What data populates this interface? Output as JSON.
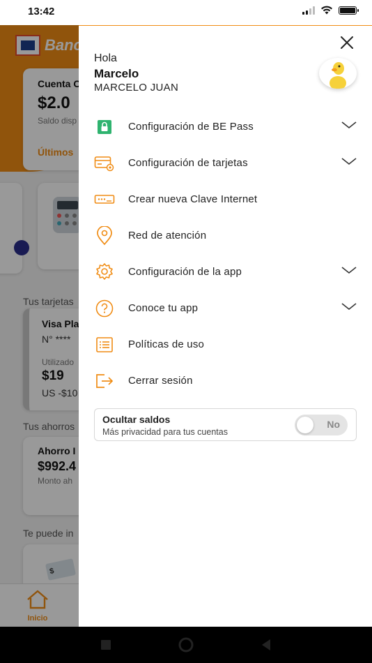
{
  "status_bar": {
    "time": "13:42"
  },
  "background": {
    "bank_name": "Banc",
    "account_title": "Cuenta C",
    "account_amount": "$2.0",
    "account_sub": "Saldo disp",
    "recent_link": "Últimos",
    "cards_label": "Tus tarjetas",
    "card_name": "Visa Pla",
    "card_number": "N° ****",
    "card_used_label": "Utilizado",
    "card_amount": "$19",
    "card_usd": "US -$10",
    "savings_label": "Tus ahorros",
    "savings_name": "Ahorro I",
    "savings_amount": "$992.4",
    "savings_sub": "Monto ah",
    "offer_label": "Te puede in",
    "tab_home": "Inicio"
  },
  "drawer": {
    "greeting": "Hola",
    "first_name": "Marcelo",
    "full_name": "MARCELO JUAN",
    "menu": [
      {
        "label": "Configuración de BE Pass",
        "icon": "lock-icon",
        "expandable": true
      },
      {
        "label": "Configuración de tarjetas",
        "icon": "card-settings-icon",
        "expandable": true
      },
      {
        "label": "Crear nueva Clave Internet",
        "icon": "password-icon",
        "expandable": false
      },
      {
        "label": "Red de atención",
        "icon": "location-pin-icon",
        "expandable": false
      },
      {
        "label": "Configuración de la app",
        "icon": "gear-icon",
        "expandable": true
      },
      {
        "label": "Conoce tu app",
        "icon": "help-icon",
        "expandable": true
      },
      {
        "label": "Políticas de uso",
        "icon": "list-icon",
        "expandable": false
      },
      {
        "label": "Cerrar sesión",
        "icon": "logout-icon",
        "expandable": false
      }
    ],
    "hide_balances": {
      "title": "Ocultar saldos",
      "subtitle": "Más privacidad para tus cuentas",
      "toggle_text": "No"
    }
  },
  "colors": {
    "accent": "#f08c14",
    "brand_blue": "#1d3f8a",
    "overlay": "rgba(0,0,0,0.40)"
  }
}
